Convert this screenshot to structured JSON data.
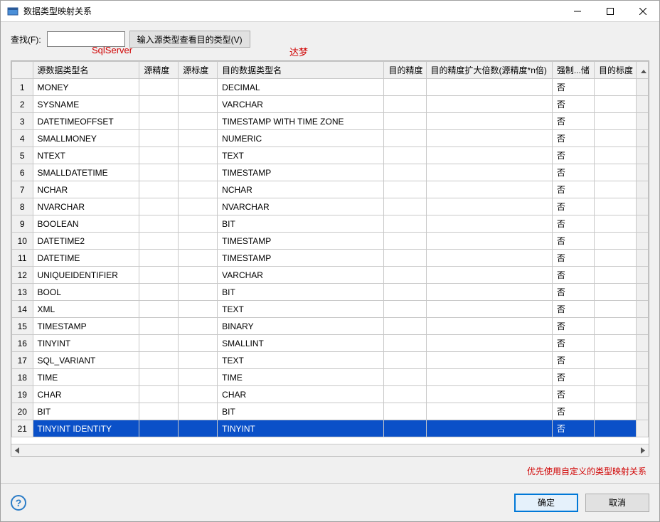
{
  "window": {
    "title": "数据类型映射关系"
  },
  "search": {
    "label": "查找(F):",
    "value": "",
    "button": "输入源类型查看目的类型(V)"
  },
  "overlay": {
    "left": "SqlServer",
    "right": "达梦"
  },
  "columns": {
    "rownum": "",
    "src_type": "源数据类型名",
    "src_prec": "源精度",
    "src_scale": "源标度",
    "dst_type": "目的数据类型名",
    "dst_prec": "目的精度",
    "dst_mul": "目的精度扩大倍数(源精度*n倍)",
    "force": "强制...储",
    "dst_scale": "目的标度"
  },
  "rows": [
    {
      "n": 1,
      "src": "MONEY",
      "dst": "DECIMAL",
      "force": "否"
    },
    {
      "n": 2,
      "src": "SYSNAME",
      "dst": "VARCHAR",
      "force": "否"
    },
    {
      "n": 3,
      "src": "DATETIMEOFFSET",
      "dst": "TIMESTAMP WITH TIME ZONE",
      "force": "否"
    },
    {
      "n": 4,
      "src": "SMALLMONEY",
      "dst": "NUMERIC",
      "force": "否"
    },
    {
      "n": 5,
      "src": "NTEXT",
      "dst": "TEXT",
      "force": "否"
    },
    {
      "n": 6,
      "src": "SMALLDATETIME",
      "dst": "TIMESTAMP",
      "force": "否"
    },
    {
      "n": 7,
      "src": "NCHAR",
      "dst": "NCHAR",
      "force": "否"
    },
    {
      "n": 8,
      "src": "NVARCHAR",
      "dst": "NVARCHAR",
      "force": "否"
    },
    {
      "n": 9,
      "src": "BOOLEAN",
      "dst": "BIT",
      "force": "否"
    },
    {
      "n": 10,
      "src": "DATETIME2",
      "dst": "TIMESTAMP",
      "force": "否"
    },
    {
      "n": 11,
      "src": "DATETIME",
      "dst": "TIMESTAMP",
      "force": "否"
    },
    {
      "n": 12,
      "src": "UNIQUEIDENTIFIER",
      "dst": "VARCHAR",
      "force": "否"
    },
    {
      "n": 13,
      "src": "BOOL",
      "dst": "BIT",
      "force": "否"
    },
    {
      "n": 14,
      "src": "XML",
      "dst": "TEXT",
      "force": "否"
    },
    {
      "n": 15,
      "src": "TIMESTAMP",
      "dst": "BINARY",
      "force": "否"
    },
    {
      "n": 16,
      "src": "TINYINT",
      "dst": "SMALLINT",
      "force": "否"
    },
    {
      "n": 17,
      "src": "SQL_VARIANT",
      "dst": "TEXT",
      "force": "否"
    },
    {
      "n": 18,
      "src": "TIME",
      "dst": "TIME",
      "force": "否"
    },
    {
      "n": 19,
      "src": "CHAR",
      "dst": "CHAR",
      "force": "否"
    },
    {
      "n": 20,
      "src": "BIT",
      "dst": "BIT",
      "force": "否"
    },
    {
      "n": 21,
      "src": "TINYINT IDENTITY",
      "dst": "TINYINT",
      "force": "否",
      "selected": true
    }
  ],
  "note": "优先使用自定义的类型映射关系",
  "footer": {
    "ok": "确定",
    "cancel": "取消"
  }
}
